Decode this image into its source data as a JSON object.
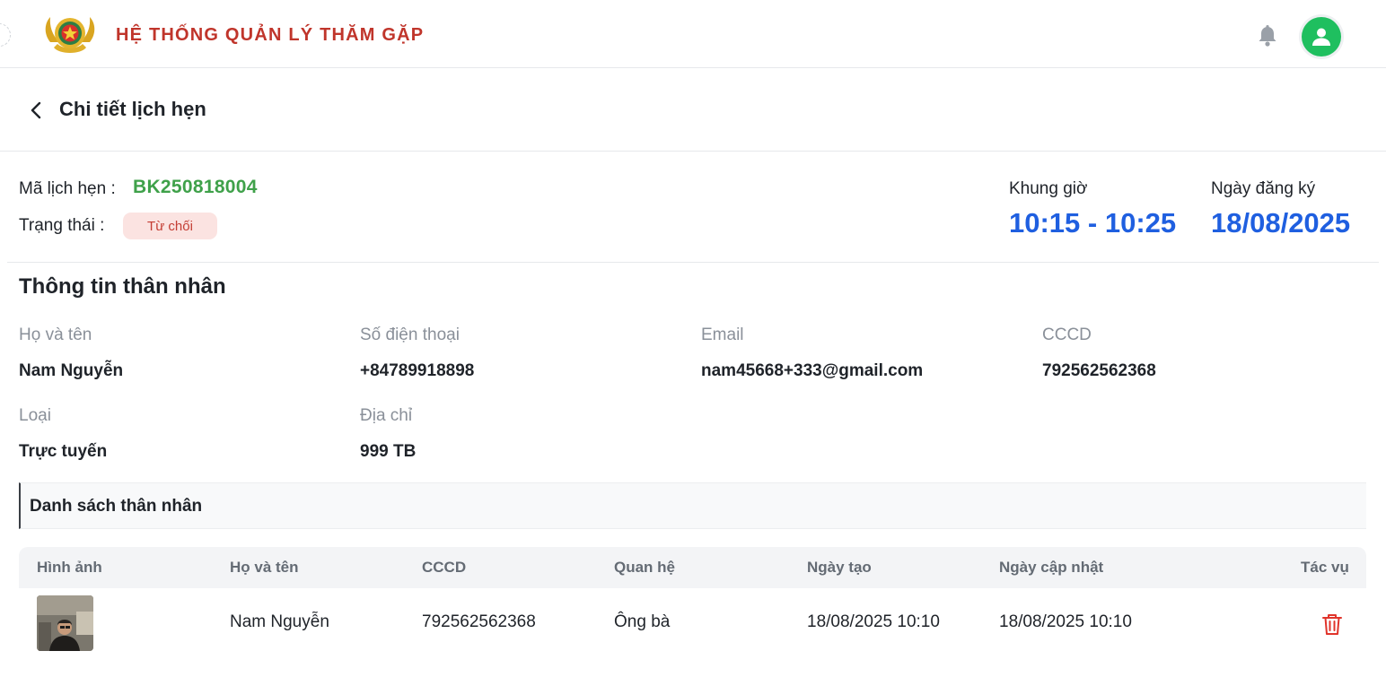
{
  "header": {
    "app_title": "HỆ THỐNG QUẢN LÝ THĂM GẶP",
    "logo_icon": "police-emblem-icon",
    "bell_icon": "bell-icon",
    "avatar_icon": "user-icon"
  },
  "page": {
    "title": "Chi tiết lịch hẹn",
    "back_icon": "chevron-left-icon"
  },
  "summary": {
    "code_label": "Mã lịch hẹn :",
    "code_value": "BK250818004",
    "status_label": "Trạng thái :",
    "status_value": "Từ chối",
    "slot_label": "Khung giờ",
    "slot_value": "10:15 - 10:25",
    "date_label": "Ngày đăng ký",
    "date_value": "18/08/2025"
  },
  "relative_info": {
    "title": "Thông tin thân nhân",
    "fields": [
      {
        "label": "Họ và tên",
        "value": "Nam Nguyễn"
      },
      {
        "label": "Số điện thoại",
        "value": "+84789918898"
      },
      {
        "label": "Email",
        "value": "nam45668+333@gmail.com"
      },
      {
        "label": "CCCD",
        "value": "792562562368"
      },
      {
        "label": "Loại",
        "value": "Trực tuyến"
      },
      {
        "label": "Địa chỉ",
        "value": "999 TB"
      }
    ]
  },
  "relatives_list": {
    "title": "Danh sách thân nhân",
    "columns": [
      "Hình ảnh",
      "Họ và tên",
      "CCCD",
      "Quan hệ",
      "Ngày tạo",
      "Ngày cập nhật",
      "Tác vụ"
    ],
    "rows": [
      {
        "name": "Nam Nguyễn",
        "id_number": "792562562368",
        "relation": "Ông bà",
        "created": "18/08/2025 10:10",
        "updated": "18/08/2025 10:10",
        "action_icon": "trash-icon"
      }
    ]
  },
  "colors": {
    "brand_red": "#c0352b",
    "code_green": "#3fa14a",
    "accent_blue": "#1f5fe0",
    "avatar_green": "#1fbf5f",
    "status_bg": "#fbe3e1",
    "delete_red": "#e0342b"
  }
}
